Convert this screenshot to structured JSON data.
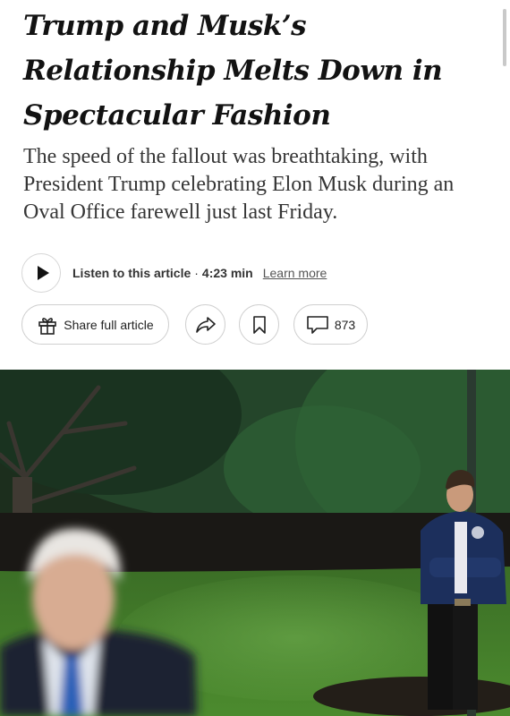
{
  "article": {
    "headline": "Trump and Musk’s Relationship Melts Down in Spectacular Fashion",
    "summary": "The speed of the fallout was breathtaking, with President Trump celebrating Elon Musk during an Oval Office farewell just last Friday."
  },
  "audio": {
    "listen_label": "Listen to this article",
    "separator": "·",
    "duration": "4:23 min",
    "learn_more": "Learn more"
  },
  "actions": {
    "share_full_label": "Share full article",
    "comment_count": "873"
  },
  "icons": {
    "play": "play-icon",
    "gift": "gift-icon",
    "share": "share-arrow-icon",
    "bookmark": "bookmark-icon",
    "comment": "comment-icon"
  },
  "colors": {
    "text": "#121212",
    "summary_text": "#363636",
    "border": "#d0d0d0",
    "lawn": "#3f7a26",
    "foliage": "#1f3a22"
  }
}
